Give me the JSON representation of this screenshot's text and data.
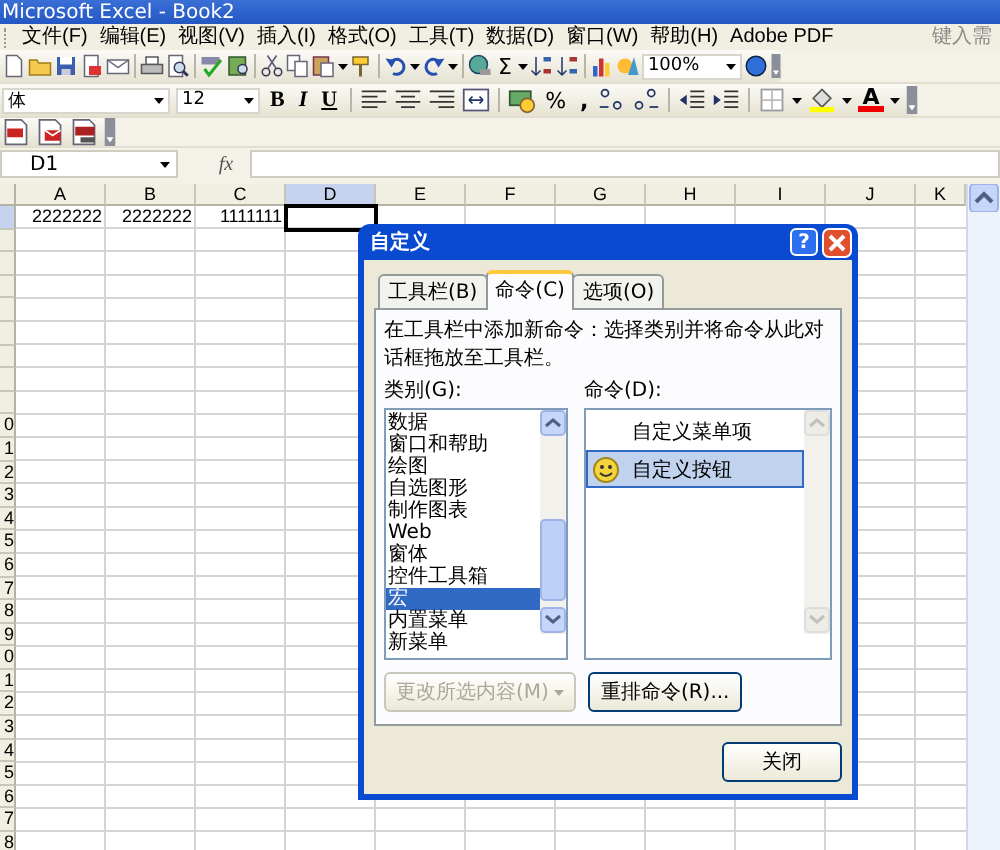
{
  "window": {
    "title": "Microsoft Excel - Book2"
  },
  "menu": {
    "items": [
      "文件(F)",
      "编辑(E)",
      "视图(V)",
      "插入(I)",
      "格式(O)",
      "工具(T)",
      "数据(D)",
      "窗口(W)",
      "帮助(H)",
      "Adobe PDF"
    ],
    "help_search": {
      "placeholder": "键入需"
    }
  },
  "standard_toolbar": {
    "sum": "Σ",
    "zoom": "100%"
  },
  "formatting_toolbar": {
    "font": "体",
    "size": "12",
    "bold": "B",
    "italic": "I",
    "underline": "U",
    "percent": "%",
    "comma": ",",
    "font_color": "A"
  },
  "formula_bar": {
    "name_box": "D1",
    "function_label": "fx"
  },
  "sheet": {
    "columns": [
      {
        "label": "A",
        "selected": false
      },
      {
        "label": "B",
        "selected": false
      },
      {
        "label": "C",
        "selected": false
      },
      {
        "label": "D",
        "selected": true
      },
      {
        "label": "E",
        "selected": false
      },
      {
        "label": "F",
        "selected": false
      },
      {
        "label": "G",
        "selected": false
      },
      {
        "label": "H",
        "selected": false
      },
      {
        "label": "I",
        "selected": false
      },
      {
        "label": "J",
        "selected": false
      },
      {
        "label": "K",
        "selected": false
      }
    ],
    "rows": [
      {
        "selected": true,
        "cells": [
          "2222222",
          "2222222",
          "1111111"
        ]
      },
      {
        "selected": false
      },
      {
        "selected": false
      },
      {
        "selected": false
      },
      {
        "selected": false
      },
      {
        "selected": false
      },
      {
        "selected": false
      },
      {
        "selected": false
      },
      {
        "selected": false
      },
      {
        "selected": false,
        "header": "0"
      },
      {
        "selected": false,
        "header": "1"
      },
      {
        "selected": false,
        "header": "2"
      },
      {
        "selected": false,
        "header": "3"
      },
      {
        "selected": false,
        "header": "4"
      },
      {
        "selected": false,
        "header": "5"
      },
      {
        "selected": false,
        "header": "6"
      },
      {
        "selected": false,
        "header": "7"
      },
      {
        "selected": false,
        "header": "8"
      },
      {
        "selected": false,
        "header": "9"
      },
      {
        "selected": false,
        "header": "0"
      },
      {
        "selected": false,
        "header": "1"
      },
      {
        "selected": false,
        "header": "2"
      },
      {
        "selected": false,
        "header": "3"
      },
      {
        "selected": false,
        "header": "4"
      },
      {
        "selected": false,
        "header": "5"
      },
      {
        "selected": false,
        "header": "6"
      },
      {
        "selected": false,
        "header": "7"
      },
      {
        "selected": false,
        "header": "8"
      }
    ]
  },
  "dialog": {
    "title": "自定义",
    "help_button": "?",
    "tabs": [
      {
        "label": "工具栏(B)",
        "selected": false
      },
      {
        "label": "命令(C)",
        "selected": true
      },
      {
        "label": "选项(O)",
        "selected": false
      }
    ],
    "instruction": "在工具栏中添加新命令：选择类别并将命令从此对话框拖放至工具栏。",
    "categories_label": "类别(G):",
    "categories": [
      {
        "label": "数据",
        "selected": false
      },
      {
        "label": "窗口和帮助",
        "selected": false
      },
      {
        "label": "绘图",
        "selected": false
      },
      {
        "label": "自选图形",
        "selected": false
      },
      {
        "label": "制作图表",
        "selected": false
      },
      {
        "label": "Web",
        "selected": false
      },
      {
        "label": "窗体",
        "selected": false
      },
      {
        "label": "控件工具箱",
        "selected": false
      },
      {
        "label": "宏",
        "selected": true
      },
      {
        "label": "内置菜单",
        "selected": false
      },
      {
        "label": "新菜单",
        "selected": false
      }
    ],
    "commands_label": "命令(D):",
    "commands": [
      {
        "label": "自定义菜单项",
        "kind": "menu_item",
        "selected": false
      },
      {
        "label": "自定义按钮",
        "kind": "button",
        "selected": true
      }
    ],
    "modify_button": {
      "label": "更改所选内容(M)",
      "disabled": true
    },
    "rearrange_button": {
      "label": "重排命令(R)..."
    },
    "close_button": {
      "label": "关闭"
    }
  }
}
